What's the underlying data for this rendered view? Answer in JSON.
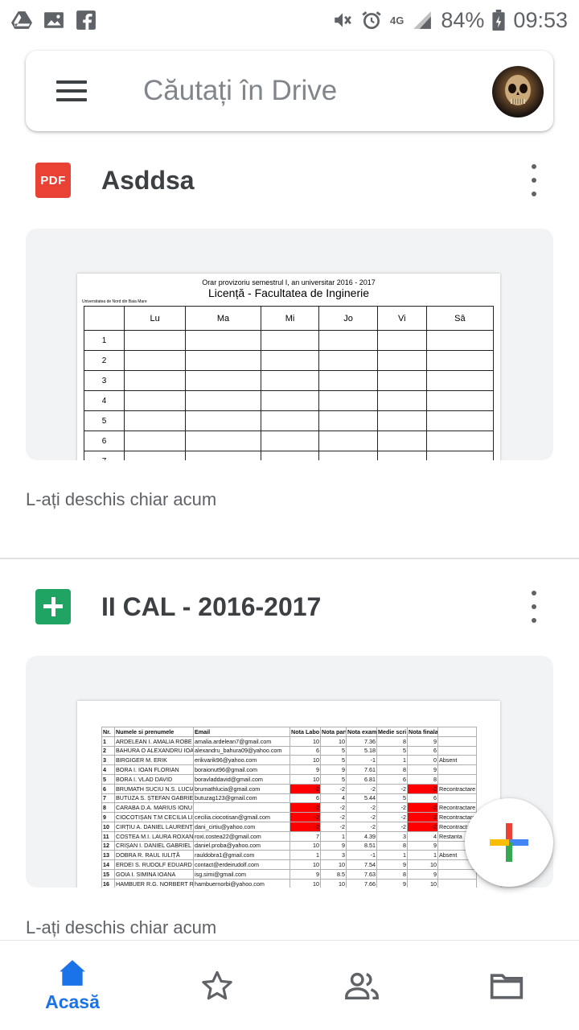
{
  "status_bar": {
    "battery": "84%",
    "time": "09:53",
    "network": "4G",
    "icons": [
      "drive-icon",
      "image-icon",
      "facebook-icon",
      "mute-icon",
      "alarm-icon",
      "signal-icon",
      "battery-icon"
    ]
  },
  "search": {
    "placeholder": "Căutați în Drive"
  },
  "files": [
    {
      "title": "Asddsa",
      "type": "PDF",
      "type_label": "PDF",
      "opened": "L-ați deschis chiar acum",
      "preview": {
        "header": "Orar provizoriu semestrul I, an universitar 2016 - 2017",
        "title": "Licență - Facultatea de Inginerie",
        "university": "Universitatea de Nord din Baia Mare",
        "days": [
          "Lu",
          "Ma",
          "Mi",
          "Jo",
          "Vi",
          "Sâ"
        ],
        "rows": [
          "1",
          "2",
          "3",
          "4",
          "5",
          "6",
          "7"
        ]
      }
    },
    {
      "title": "II CAL - 2016-2017",
      "type": "Sheets",
      "opened": "L-ați deschis chiar acum",
      "preview": {
        "columns": [
          "Nr.",
          "Numele si prenumele",
          "Email",
          "Nota Labo",
          "Nota parti",
          "Nota exam",
          "Medie scri",
          "Nota finala",
          ""
        ],
        "rows": [
          [
            "1",
            "ARDELEAN I. AMALIA ROBE",
            "amalia.ardelean7@gmail.com",
            "10",
            "10",
            "7.36",
            "8",
            "9",
            ""
          ],
          [
            "2",
            "BAHURA O ALEXANDRU IOA",
            "alexandru_bahura09@yahoo.com",
            "6",
            "5",
            "5.18",
            "5",
            "6",
            ""
          ],
          [
            "3",
            "BIRGIGER M. ERIK",
            "erikvarik96@yahoo.com",
            "10",
            "5",
            "-1",
            "1",
            "0",
            "Absent"
          ],
          [
            "4",
            "BORA I. IOAN FLORIAN",
            "boraionut96@gmail.com",
            "9",
            "9",
            "7.61",
            "8",
            "9",
            ""
          ],
          [
            "5",
            "BORA I. VLAD DAVID",
            "boravladdavid@gmail.com",
            "10",
            "5",
            "6.81",
            "6",
            "8",
            ""
          ],
          [
            "6",
            "BRUMATH SUCIU N.S. LUCIA",
            "brumathlucia@gmail.com",
            "-2",
            "-2",
            "-2",
            "-2",
            "-2",
            "Recontractare"
          ],
          [
            "7",
            "BUTUZA S. ȘTEFAN GABRIE",
            "butuzag123@gmail.com",
            "6",
            "4",
            "5.44",
            "5",
            "6",
            ""
          ],
          [
            "8",
            "CARABA D.A. MARIUS IONU",
            "",
            "-2",
            "-2",
            "-2",
            "-2",
            "-2",
            "Recontractare"
          ],
          [
            "9",
            "CIOCOTIȘAN T.M CECILIA LI",
            "cecilia.ciocotisan@gmail.com",
            "-2",
            "-2",
            "-2",
            "-2",
            "-2",
            "Recontractare"
          ],
          [
            "10",
            "CIRȚIU A. DANIEL LAURENȚ",
            "dani_cirtiu@yahoo.com",
            "-2",
            "-2",
            "-2",
            "-2",
            "-2",
            "Recontractare"
          ],
          [
            "11",
            "COSTEA M.I. LAURA ROXAN",
            "roxi.costea22@gmail.com",
            "7",
            "1",
            "4.39",
            "3",
            "4",
            "Restanta"
          ],
          [
            "12",
            "CRIȘAN I. DANIEL GABRIEL",
            "daniel.proba@yahoo.com",
            "10",
            "9",
            "8.51",
            "8",
            "9",
            ""
          ],
          [
            "13",
            "DOBRA R. RAUL IULIȚĂ",
            "rauldobra1@gmail.com",
            "1",
            "3",
            "-1",
            "1",
            "1",
            "Absent"
          ],
          [
            "14",
            "ERDEI S. RUDOLF EDUARD",
            "contact@erdeirudolf.com",
            "10",
            "10",
            "7.54",
            "9",
            "10",
            ""
          ],
          [
            "15",
            "GOIA I. SIMINA IOANA",
            "isg.simi@gmail.com",
            "9",
            "8.5",
            "7.63",
            "8",
            "9",
            ""
          ],
          [
            "16",
            "HAMBUER R.G. NORBERT R",
            "hambuernorbi@yahoo.com",
            "10",
            "10",
            "7.66",
            "9",
            "10",
            ""
          ]
        ],
        "red_cells": [
          [
            5,
            3
          ],
          [
            5,
            7
          ],
          [
            7,
            3
          ],
          [
            7,
            7
          ],
          [
            8,
            3
          ],
          [
            8,
            7
          ],
          [
            9,
            3
          ],
          [
            9,
            7
          ]
        ]
      }
    }
  ],
  "bottom_nav": {
    "items": [
      {
        "label": "Acasă",
        "icon": "home-icon",
        "active": true
      },
      {
        "label": "",
        "icon": "star-icon",
        "active": false
      },
      {
        "label": "",
        "icon": "shared-icon",
        "active": false
      },
      {
        "label": "",
        "icon": "folder-icon",
        "active": false
      }
    ]
  },
  "colors": {
    "accent": "#1a73e8",
    "pdf_red": "#e94235",
    "sheets_green": "#1fa463",
    "cell_red": "#ff0000"
  }
}
